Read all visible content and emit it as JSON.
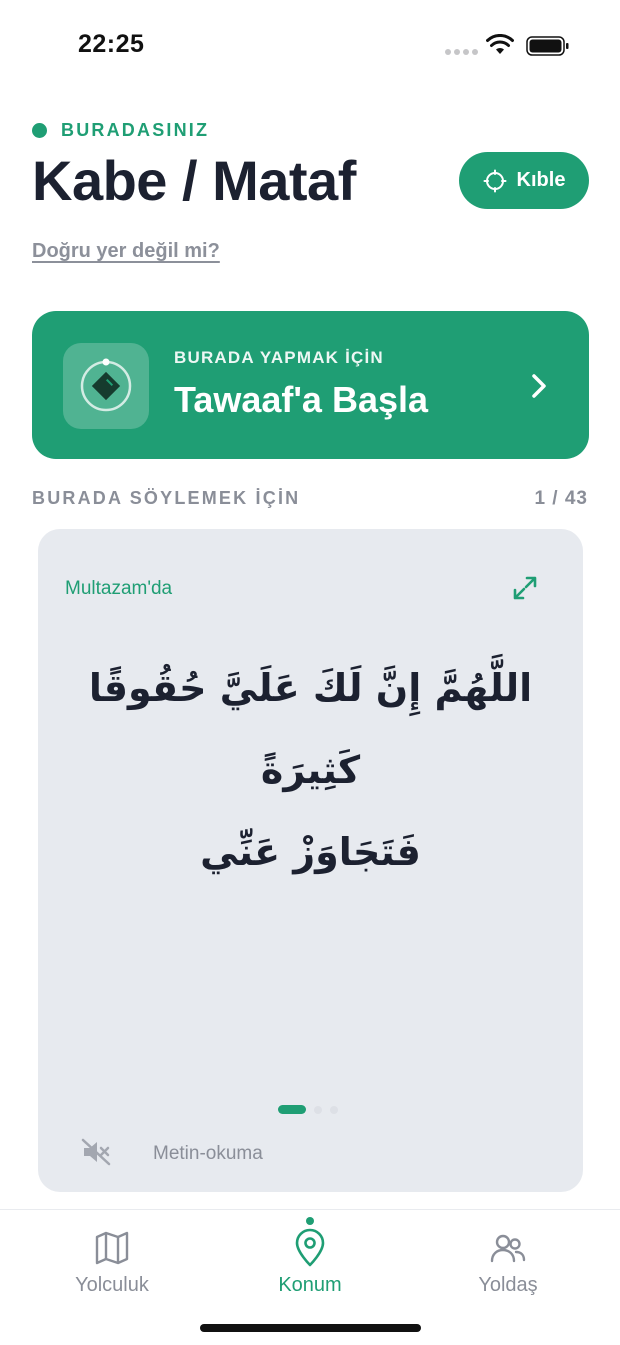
{
  "status_bar": {
    "time": "22:25"
  },
  "header": {
    "location_label": "BURADASINIZ",
    "title": "Kabe / Mataf",
    "qibla_button": "Kıble",
    "wrong_place_link": "Doğru yer değil mi?"
  },
  "action_card": {
    "eyebrow": "BURADA YAPMAK İÇİN",
    "title": "Tawaaf'a Başla"
  },
  "prayers_section": {
    "label": "BURADA SÖYLEMEK İÇİN",
    "counter": "1 / 43",
    "card": {
      "place": "Multazam'da",
      "arabic_line1": "اللَّهُمَّ إِنَّ لَكَ عَلَيَّ حُقُوقًا كَثِيرَةً",
      "arabic_line2": "فَتَجَاوَزْ عَنِّي",
      "tts_label": "Metin-okuma",
      "active_page_index": 0
    }
  },
  "tab_bar": {
    "tabs": [
      {
        "label": "Yolculuk",
        "icon": "map-icon",
        "active": false
      },
      {
        "label": "Konum",
        "icon": "location-pin-icon",
        "active": true
      },
      {
        "label": "Yoldaş",
        "icon": "companions-icon",
        "active": false
      }
    ]
  },
  "colors": {
    "accent": "#1f9e74",
    "card_background": "#e7eaef",
    "muted_text": "#8a8e98",
    "title_text": "#1c2130"
  }
}
